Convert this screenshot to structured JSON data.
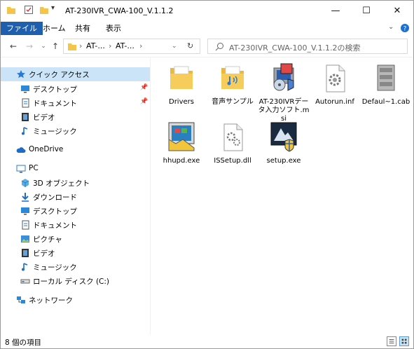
{
  "window": {
    "title": "AT-230IVR_CWA-100_V.1.1.2",
    "controls": {
      "minimize": "—",
      "maximize": "☐",
      "close": "✕"
    }
  },
  "ribbon": {
    "tabs": [
      {
        "label": "ファイル",
        "active": true
      },
      {
        "label": "ホーム"
      },
      {
        "label": "共有"
      },
      {
        "label": "表示"
      }
    ]
  },
  "address": {
    "crumbs": [
      "AT-...",
      "AT-..."
    ],
    "search_placeholder": "AT-230IVR_CWA-100_V.1.1.2の検索"
  },
  "nav": {
    "items": [
      {
        "label": "クイック アクセス",
        "icon": "star-icon",
        "selected": true,
        "indent": 0
      },
      {
        "label": "デスクトップ",
        "icon": "desktop-icon",
        "pinned": true,
        "indent": 1
      },
      {
        "label": "ドキュメント",
        "icon": "documents-icon",
        "pinned": true,
        "indent": 1
      },
      {
        "label": "ビデオ",
        "icon": "video-icon",
        "indent": 1
      },
      {
        "label": "ミュージック",
        "icon": "music-icon",
        "indent": 1
      },
      {
        "label": "OneDrive",
        "icon": "cloud-icon",
        "indent": 0
      },
      {
        "label": "PC",
        "icon": "pc-icon",
        "indent": 0
      },
      {
        "label": "3D オブジェクト",
        "icon": "3d-objects-icon",
        "indent": 1
      },
      {
        "label": "ダウンロード",
        "icon": "download-icon",
        "indent": 1
      },
      {
        "label": "デスクトップ",
        "icon": "desktop-icon",
        "indent": 1
      },
      {
        "label": "ドキュメント",
        "icon": "documents-icon",
        "indent": 1
      },
      {
        "label": "ピクチャ",
        "icon": "pictures-icon",
        "indent": 1
      },
      {
        "label": "ビデオ",
        "icon": "video-icon",
        "indent": 1
      },
      {
        "label": "ミュージック",
        "icon": "music-icon",
        "indent": 1
      },
      {
        "label": "ローカル ディスク (C:)",
        "icon": "disk-icon",
        "indent": 1
      },
      {
        "label": "ネットワーク",
        "icon": "network-icon",
        "indent": 0
      }
    ]
  },
  "files": [
    {
      "name": "Drivers",
      "icon": "folder-icon"
    },
    {
      "name": "音声サンプル",
      "icon": "audio-folder-icon"
    },
    {
      "name": "AT-230IVRデータ入力ソフト.msi",
      "icon": "msi-installer-icon"
    },
    {
      "name": "Autorun.inf",
      "icon": "settings-file-icon"
    },
    {
      "name": "Defaul~1.cab",
      "icon": "cab-archive-icon"
    },
    {
      "name": "hhupd.exe",
      "icon": "exe-icon"
    },
    {
      "name": "ISSetup.dll",
      "icon": "dll-file-icon"
    },
    {
      "name": "setup.exe",
      "icon": "setup-icon"
    }
  ],
  "status": {
    "count_text": "8 個の項目"
  },
  "colors": {
    "accent": "#1f5fb0",
    "selection": "#cce4f7",
    "folder": "#f3c54b"
  }
}
